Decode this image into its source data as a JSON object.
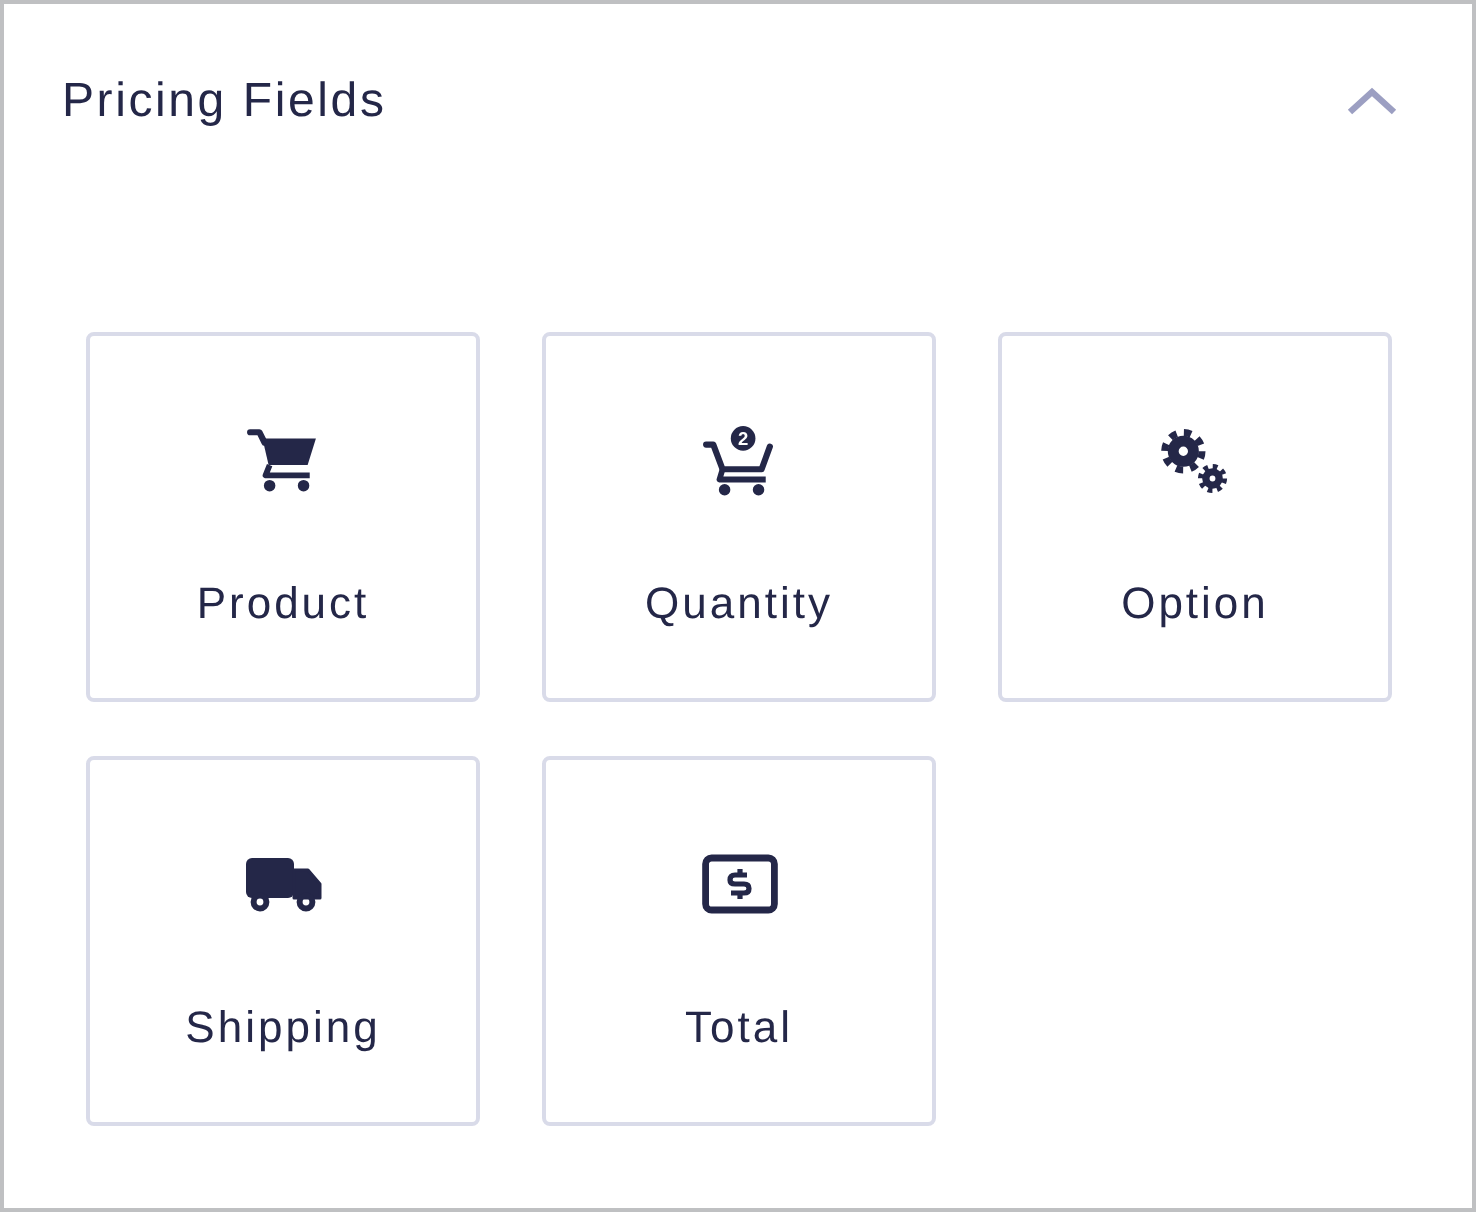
{
  "panel": {
    "title": "Pricing Fields",
    "expanded": true
  },
  "fields": [
    {
      "kind": "product",
      "label": "Product"
    },
    {
      "kind": "quantity",
      "label": "Quantity",
      "badge": "2"
    },
    {
      "kind": "option",
      "label": "Option"
    },
    {
      "kind": "shipping",
      "label": "Shipping"
    },
    {
      "kind": "total",
      "label": "Total"
    }
  ]
}
